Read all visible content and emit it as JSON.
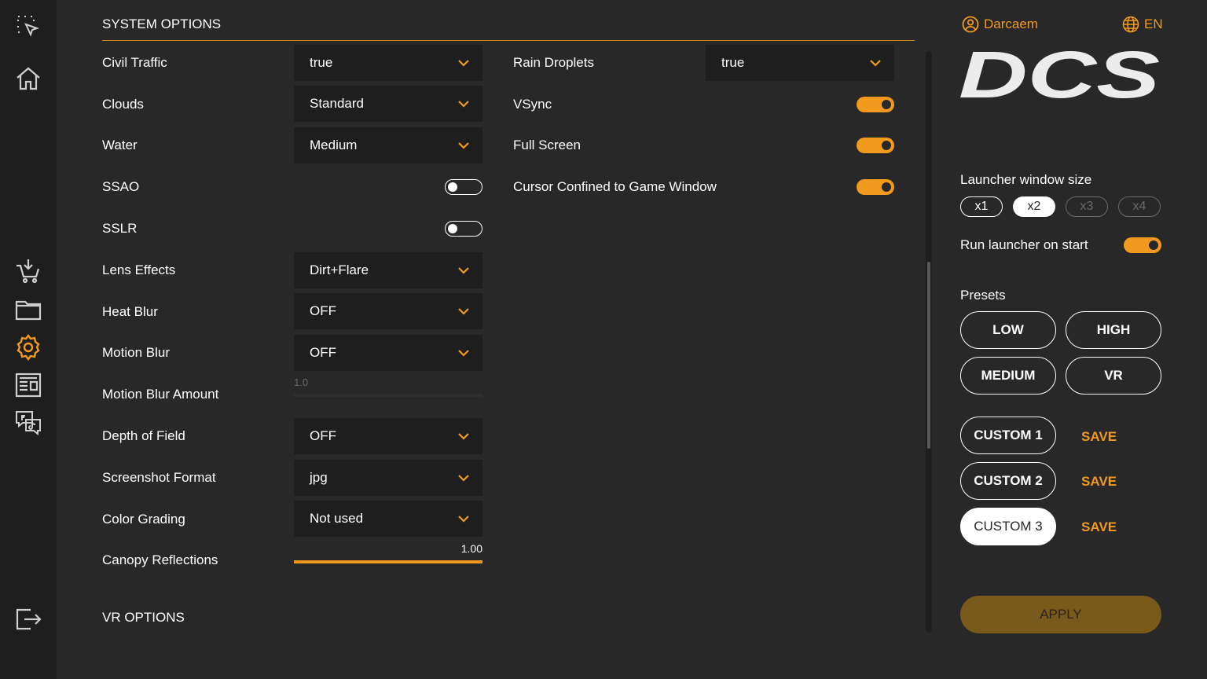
{
  "sidebar": {
    "icons": [
      "select-icon",
      "home-icon",
      "store-cart-icon",
      "folder-icon",
      "settings-icon",
      "news-icon",
      "social-icon",
      "exit-icon"
    ],
    "active": "settings-icon"
  },
  "main": {
    "system_title": "SYSTEM OPTIONS",
    "vr_title": "VR OPTIONS",
    "left_options": [
      {
        "label": "Civil Traffic",
        "type": "dropdown",
        "value": "true"
      },
      {
        "label": "Clouds",
        "type": "dropdown",
        "value": "Standard"
      },
      {
        "label": "Water",
        "type": "dropdown",
        "value": "Medium"
      },
      {
        "label": "SSAO",
        "type": "toggle",
        "value": "off"
      },
      {
        "label": "SSLR",
        "type": "toggle",
        "value": "off"
      },
      {
        "label": "Lens Effects",
        "type": "dropdown",
        "value": "Dirt+Flare"
      },
      {
        "label": "Heat Blur",
        "type": "dropdown",
        "value": "OFF"
      },
      {
        "label": "Motion Blur",
        "type": "dropdown",
        "value": "OFF"
      },
      {
        "label": "Motion Blur Amount",
        "type": "slider",
        "value": "1.0",
        "fill": 0
      },
      {
        "label": "Depth of Field",
        "type": "dropdown",
        "value": "OFF"
      },
      {
        "label": "Screenshot Format",
        "type": "dropdown",
        "value": "jpg"
      },
      {
        "label": "Color Grading",
        "type": "dropdown",
        "value": "Not used"
      },
      {
        "label": "Canopy Reflections",
        "type": "slider",
        "value": "1.00",
        "fill": 1.0
      }
    ],
    "right_options": [
      {
        "label": "Rain Droplets",
        "type": "dropdown",
        "value": "true"
      },
      {
        "label": "VSync",
        "type": "toggle",
        "value": "on"
      },
      {
        "label": "Full Screen",
        "type": "toggle",
        "value": "on"
      },
      {
        "label": "Cursor Confined to Game Window",
        "type": "toggle",
        "value": "on"
      }
    ]
  },
  "panel": {
    "username": "Darcaem",
    "language": "EN",
    "logo_text": "DCS",
    "window_size_label": "Launcher window size",
    "window_sizes": [
      "x1",
      "x2",
      "x3",
      "x4"
    ],
    "window_size_selected": "x2",
    "run_on_start_label": "Run launcher on start",
    "run_on_start": "on",
    "presets_label": "Presets",
    "presets": [
      "LOW",
      "HIGH",
      "MEDIUM",
      "VR"
    ],
    "custom_presets": [
      "CUSTOM 1",
      "CUSTOM 2",
      "CUSTOM 3"
    ],
    "custom_selected": "CUSTOM 3",
    "save_label": "SAVE",
    "apply_label": "APPLY"
  },
  "colors": {
    "accent": "#f29a1d",
    "background": "#282828",
    "sidebar": "#1e1e1e",
    "control_bg": "#1e1e1e",
    "apply_bg": "#7a5a1c"
  }
}
